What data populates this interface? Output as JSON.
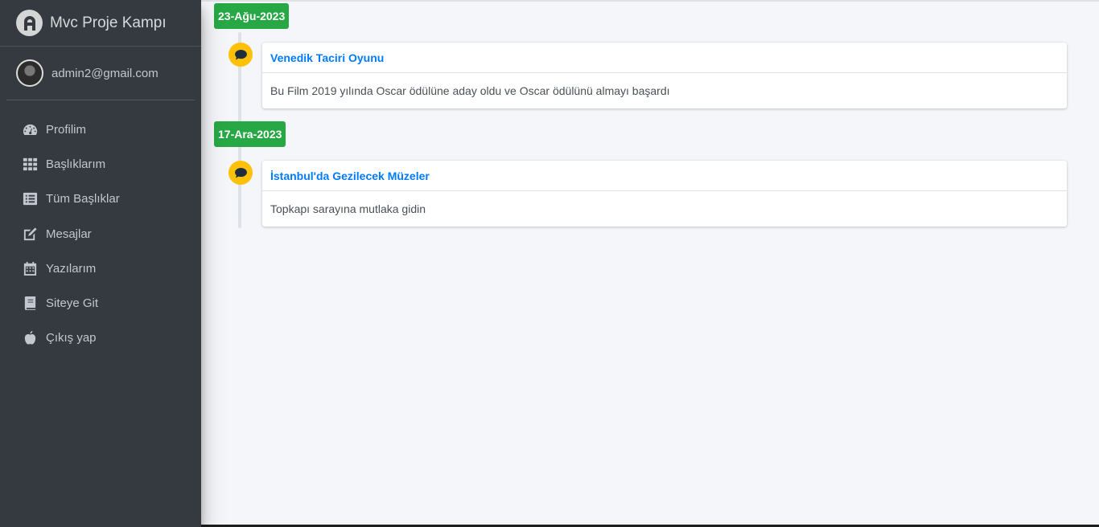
{
  "brand": {
    "title": "Mvc Proje Kampı"
  },
  "user": {
    "email": "admin2@gmail.com"
  },
  "nav": [
    {
      "label": "Profilim",
      "icon": "dashboard-icon"
    },
    {
      "label": "Başlıklarım",
      "icon": "grid-icon"
    },
    {
      "label": "Tüm Başlıklar",
      "icon": "list-icon"
    },
    {
      "label": "Mesajlar",
      "icon": "edit-icon"
    },
    {
      "label": "Yazılarım",
      "icon": "calendar-icon"
    },
    {
      "label": "Siteye Git",
      "icon": "book-icon"
    },
    {
      "label": "Çıkış yap",
      "icon": "apple-icon"
    }
  ],
  "timeline": [
    {
      "date": "23-Ağu-2023",
      "title": "Venedik Taciri Oyunu",
      "body": "Bu Film 2019 yılında Oscar ödülüne aday oldu ve Oscar ödülünü almayı başardı"
    },
    {
      "date": "17-Ara-2023",
      "title": "İstanbul'da Gezilecek Müzeler",
      "body": "Topkapı sarayına mutlaka gidin"
    }
  ],
  "colors": {
    "sidebar": "#343a40",
    "date_label": "#28a745",
    "timeline_icon": "#ffc107",
    "link": "#007bff"
  }
}
